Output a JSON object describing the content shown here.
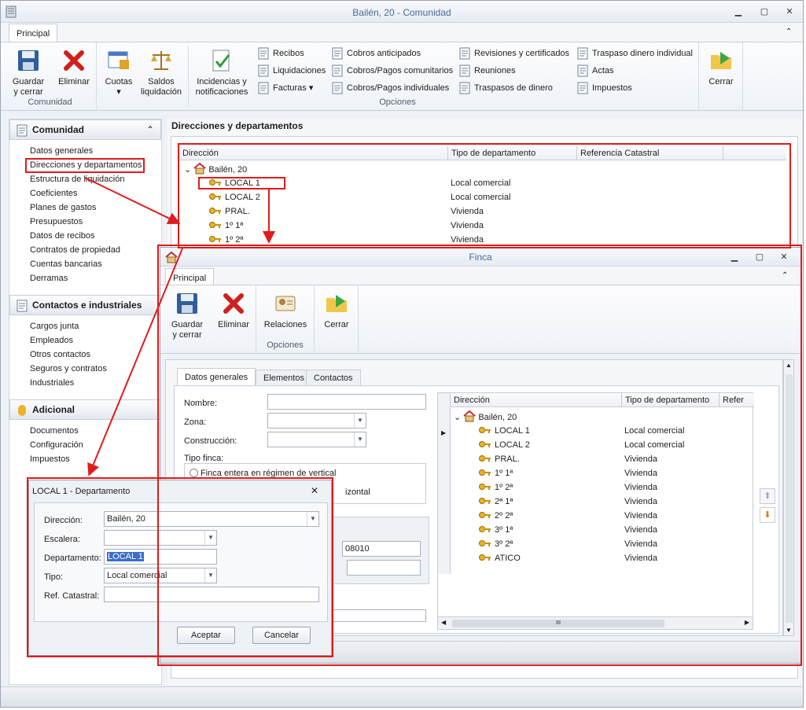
{
  "main": {
    "title": "Bailén, 20 - Comunidad",
    "tab": "Principal",
    "ribbon": {
      "guardar": "Guardar\ny cerrar",
      "eliminar": "Eliminar",
      "cuotas": "Cuotas",
      "saldos": "Saldos\nliquidación",
      "incidencias": "Incidencias y\nnotificaciones",
      "recibos": "Recibos",
      "liquidaciones": "Liquidaciones",
      "facturas": "Facturas ▾",
      "cobros_anticipados": "Cobros anticipados",
      "cobros_comunitarios": "Cobros/Pagos comunitarios",
      "cobros_individuales": "Cobros/Pagos individuales",
      "revisiones": "Revisiones y certificados",
      "reuniones": "Reuniones",
      "traspasos": "Traspasos de dinero",
      "traspaso_individual": "Traspaso dinero individual",
      "actas": "Actas",
      "impuestos": "Impuestos",
      "cerrar": "Cerrar",
      "group_comunidad": "Comunidad",
      "group_opciones": "Opciones"
    },
    "sidebar": {
      "comunidad_h": "Comunidad",
      "comunidad": [
        "Datos generales",
        "Direcciones y departamentos",
        "Estructura de liquidación",
        "Coeficientes",
        "Planes de gastos",
        "Presupuestos",
        "Datos de recibos",
        "Contratos de propiedad",
        "Cuentas bancarias",
        "Derramas"
      ],
      "contactos_h": "Contactos e industriales",
      "contactos": [
        "Cargos junta",
        "Empleados",
        "Otros contactos",
        "Seguros y contratos",
        "Industriales"
      ],
      "adicional_h": "Adicional",
      "adicional": [
        "Documentos",
        "Configuración",
        "Impuestos"
      ]
    },
    "content_title": "Direcciones y departamentos",
    "grid": {
      "headers": [
        "Dirección",
        "Tipo de departamento",
        "Referencia Catastral"
      ],
      "root": "Bailén, 20",
      "rows": [
        [
          "LOCAL 1",
          "Local comercial"
        ],
        [
          "LOCAL 2",
          "Local comercial"
        ],
        [
          "PRAL.",
          "Vivienda"
        ],
        [
          "1º 1ª",
          "Vivienda"
        ],
        [
          "1º 2ª",
          "Vivienda"
        ]
      ]
    }
  },
  "finca": {
    "title": "Finca",
    "tab": "Principal",
    "ribbon": {
      "guardar": "Guardar\ny cerrar",
      "eliminar": "Eliminar",
      "relaciones": "Relaciones",
      "cerrar": "Cerrar",
      "group_opciones": "Opciones"
    },
    "tabs": [
      "Datos generales",
      "Elementos",
      "Contactos"
    ],
    "form": {
      "nombre": "Nombre:",
      "zona": "Zona:",
      "construccion": "Construcción:",
      "tipo_finca": "Tipo finca:",
      "radio1": "Finca entera en régimen de vertical",
      "radio2_tail": "izontal",
      "cp": "08010"
    },
    "grid": {
      "headers": [
        "Dirección",
        "Tipo de departamento",
        "Refer"
      ],
      "root": "Bailén, 20",
      "rows": [
        [
          "LOCAL 1",
          "Local comercial"
        ],
        [
          "LOCAL 2",
          "Local comercial"
        ],
        [
          "PRAL.",
          "Vivienda"
        ],
        [
          "1º 1ª",
          "Vivienda"
        ],
        [
          "1º 2ª",
          "Vivienda"
        ],
        [
          "2ª 1ª",
          "Vivienda"
        ],
        [
          "2º 2ª",
          "Vivienda"
        ],
        [
          "3º 1ª",
          "Vivienda"
        ],
        [
          "3º 2ª",
          "Vivienda"
        ],
        [
          "ATICO",
          "Vivienda"
        ]
      ],
      "hscroll": "III"
    }
  },
  "dept": {
    "title": "LOCAL 1 - Departamento",
    "labels": {
      "direccion": "Dirección:",
      "escalera": "Escalera:",
      "departamento": "Departamento:",
      "tipo": "Tipo:",
      "ref": "Ref. Catastral:"
    },
    "values": {
      "direccion": "Bailén, 20",
      "escalera": "",
      "departamento": "LOCAL 1",
      "tipo": "Local comercial",
      "ref": ""
    },
    "aceptar": "Aceptar",
    "cancelar": "Cancelar"
  },
  "colors": {
    "highlight": "#e01b1b",
    "title_blue": "#4a6b93"
  }
}
